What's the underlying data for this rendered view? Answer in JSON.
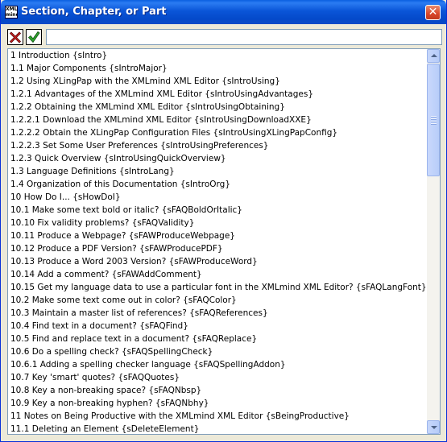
{
  "window": {
    "title": "Section, Chapter, or Part",
    "app_icon_label": "XML mind"
  },
  "toolbar": {
    "cancel_icon": "red-x-icon",
    "ok_icon": "green-check-icon",
    "search_value": ""
  },
  "items": [
    "1 Introduction {sIntro}",
    "1.1 Major Components {sIntroMajor}",
    "1.2 Using XLingPap with the XMLmind XML Editor {sIntroUsing}",
    "1.2.1 Advantages of the XMLmind XML Editor {sIntroUsingAdvantages}",
    "1.2.2 Obtaining the XMLmind XML Editor {sIntroUsingObtaining}",
    "1.2.2.1 Download the XMLmind XML Editor {sIntroUsingDownloadXXE}",
    "1.2.2.2 Obtain the XLingPap Configuration Files {sIntroUsingXLingPapConfig}",
    "1.2.2.3 Set Some User Preferences {sIntroUsingPreferences}",
    "1.2.3 Quick Overview {sIntroUsingQuickOverview}",
    "1.3 Language Definitions {sIntroLang}",
    "1.4 Organization of this Documentation {sIntroOrg}",
    "10 How Do I... {sHowDoI}",
    "10.1 Make some text bold or italic? {sFAQBoldOrItalic}",
    "10.10 Fix validity problems? {sFAQValidity}",
    "10.11 Produce a Webpage? {sFAWProduceWebpage}",
    "10.12 Produce a PDF Version? {sFAWProducePDF}",
    "10.13 Produce a Word 2003 Version? {sFAWProduceWord}",
    "10.14 Add a comment? {sFAWAddComment}",
    "10.15 Get my language data to use a particular font in the XMLmind XML Editor? {sFAQLangFont}",
    "10.2 Make some text come out in color? {sFAQColor}",
    "10.3 Maintain a master list of references? {sFAQReferences}",
    "10.4 Find text in a document? {sFAQFind}",
    "10.5 Find and replace text in a document? {sFAQReplace}",
    "10.6 Do a spelling check? {sFAQSpellingCheck}",
    "10.6.1 Adding a spelling checker language {sFAQSpellingAddon}",
    "10.7 Key 'smart' quotes? {sFAQQuotes}",
    "10.8 Key a non-breaking space? {sFAQNbsp}",
    "10.9 Key a non-breaking hyphen? {sFAQNbhy}",
    "11 Notes on Being Productive with the XMLmind XML Editor {sBeingProductive}",
    "11.1 Deleting an Element {sDeleteElement}"
  ]
}
